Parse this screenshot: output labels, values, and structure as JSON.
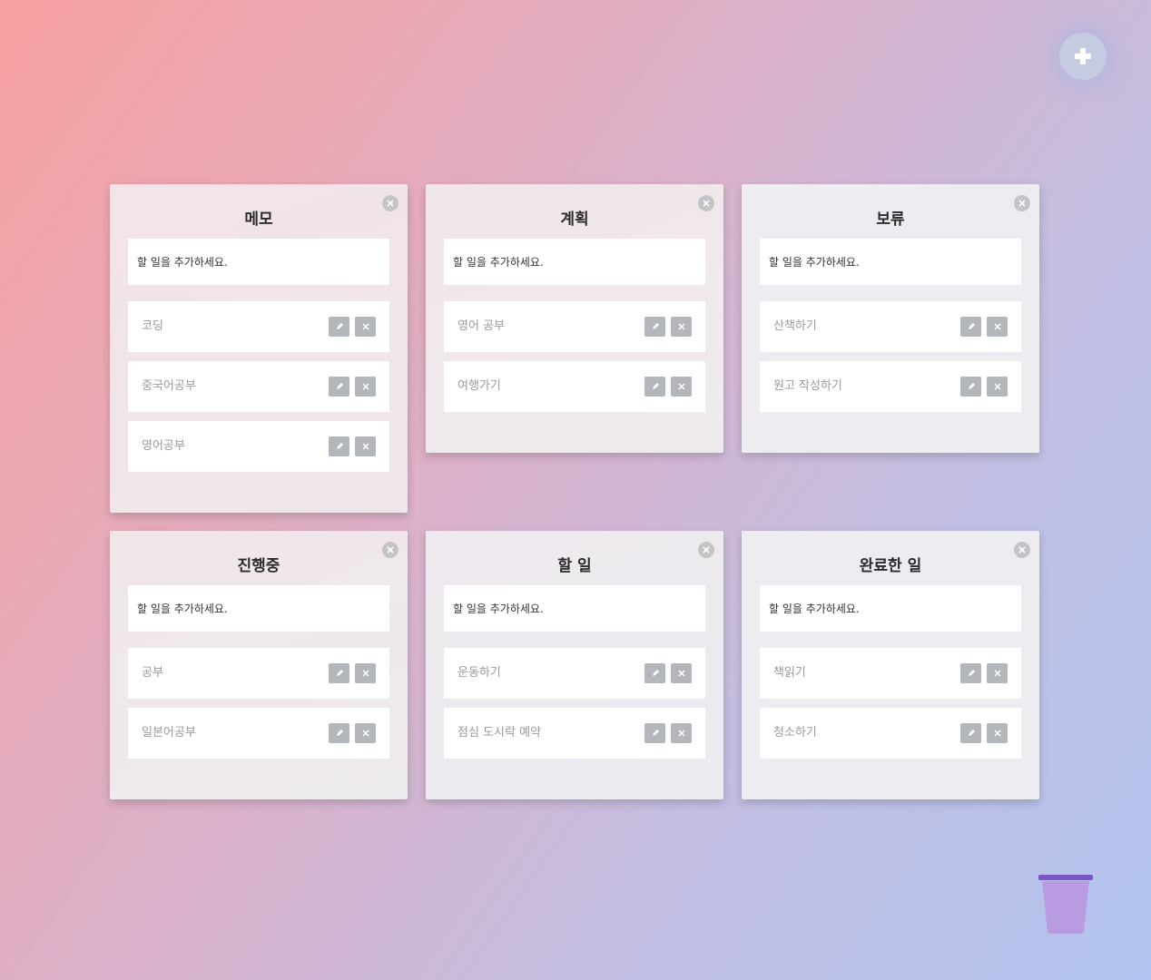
{
  "add_board": {
    "icon": "plus-icon"
  },
  "placeholder": "할 일을 추가하세요.",
  "boards": [
    {
      "title": "메모",
      "items": [
        "코딩",
        "중국어공부",
        "영어공부"
      ]
    },
    {
      "title": "계획",
      "items": [
        "영어 공부",
        "여행가기"
      ]
    },
    {
      "title": "보류",
      "items": [
        "산책하기",
        "원고 작성하기"
      ]
    },
    {
      "title": "진행중",
      "items": [
        "공부",
        "일본어공부"
      ]
    },
    {
      "title": "할 일",
      "items": [
        "운동하기",
        "점심 도시락 예약"
      ]
    },
    {
      "title": "완료한 일",
      "items": [
        "책읽기",
        "청소하기"
      ]
    }
  ],
  "icons": {
    "edit": "pencil-icon",
    "delete": "close-icon",
    "board_close": "close-circle-icon",
    "trash": "trash-can-icon"
  },
  "colors": {
    "item_button": "#b3b6ba",
    "trash": "#b89be0",
    "trash_rim": "#7b55c6"
  }
}
